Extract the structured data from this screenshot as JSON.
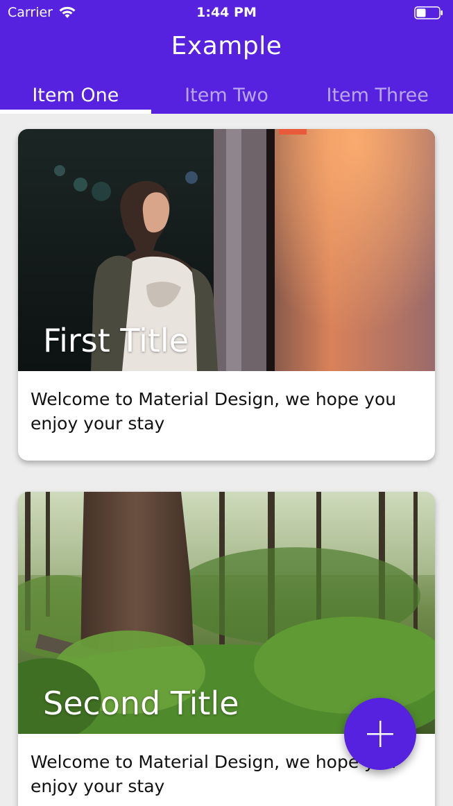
{
  "status_bar": {
    "carrier": "Carrier",
    "time": "1:44 PM"
  },
  "app_bar": {
    "title": "Example",
    "tabs": [
      {
        "label": "Item One",
        "selected": true
      },
      {
        "label": "Item Two",
        "selected": false
      },
      {
        "label": "Item Three",
        "selected": false
      }
    ]
  },
  "cards": [
    {
      "title": "First Title",
      "body": "Welcome to Material Design, we hope you enjoy your stay",
      "image": "photo-woman-night"
    },
    {
      "title": "Second Title",
      "body": "Welcome to Material Design, we hope you enjoy your stay",
      "image": "photo-forest"
    }
  ],
  "fab": {
    "icon": "plus-icon"
  },
  "colors": {
    "primary": "#5622e0",
    "background": "#ededed"
  }
}
